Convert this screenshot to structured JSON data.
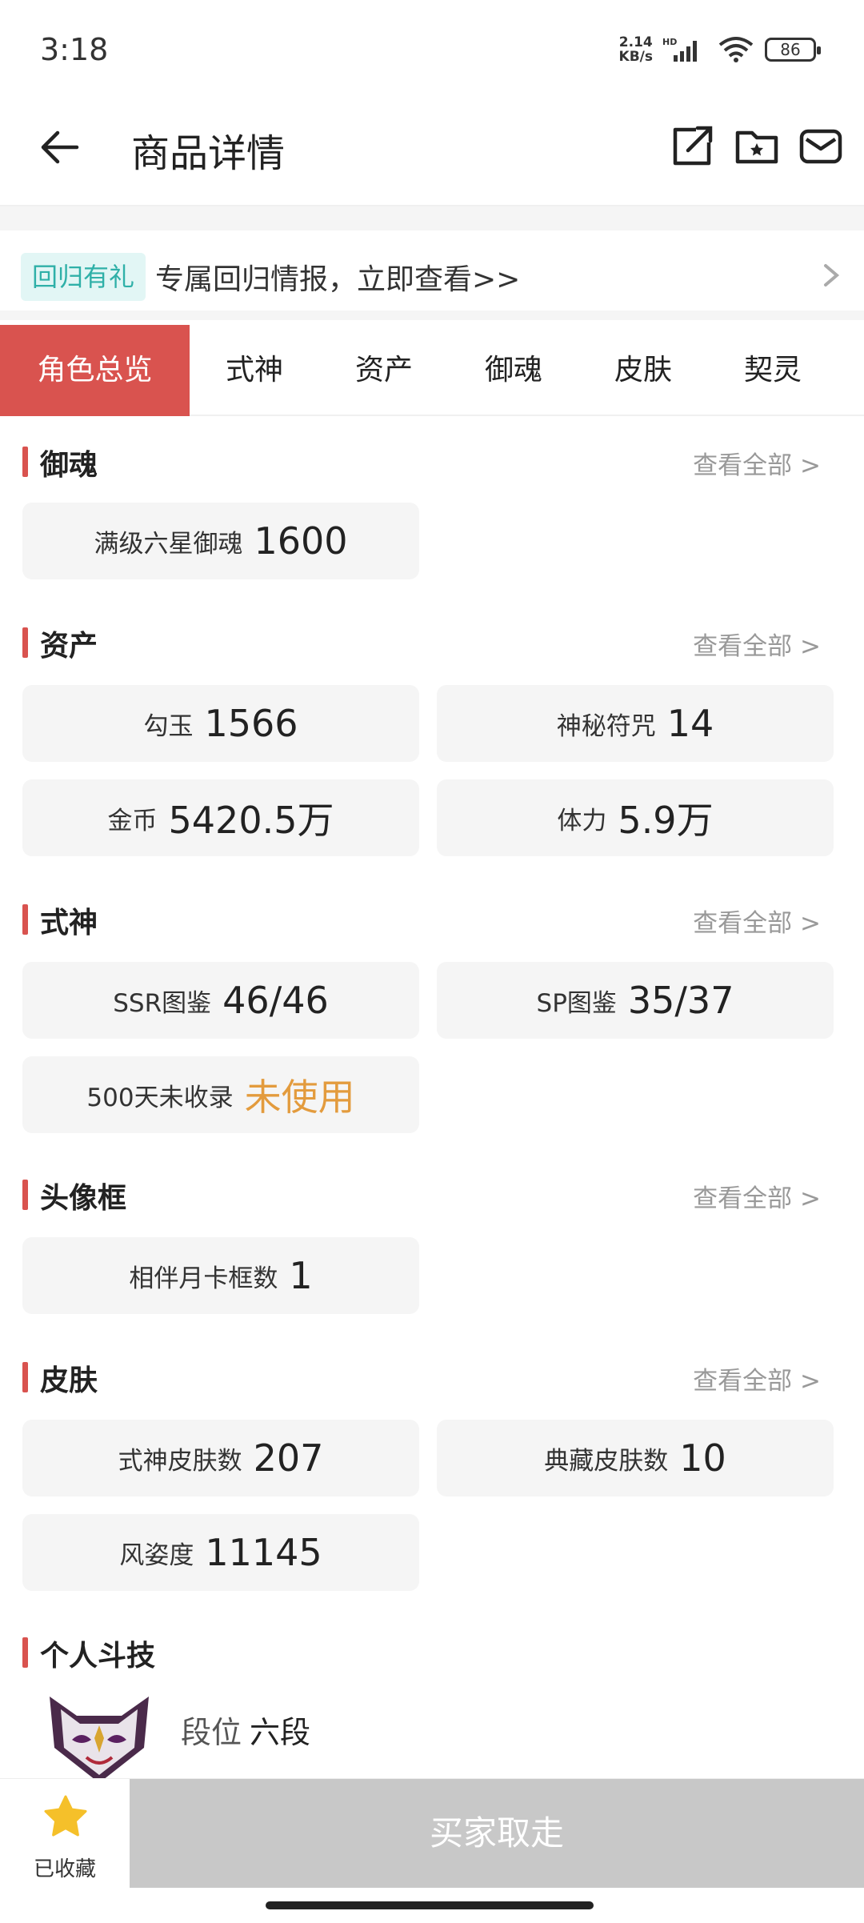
{
  "status": {
    "time": "3:18",
    "net_speed_top": "2.14",
    "net_speed_bottom": "KB/s",
    "signal_label": "HD",
    "battery": "86"
  },
  "header": {
    "title": "商品详情"
  },
  "promo": {
    "badge": "回归有礼",
    "text": "专属回归情报，立即查看>>"
  },
  "tabs": [
    "角色总览",
    "式神",
    "资产",
    "御魂",
    "皮肤",
    "契灵"
  ],
  "view_all_label": "查看全部 >",
  "sections": {
    "yuhun": {
      "title": "御魂",
      "cards": [
        {
          "label": "满级六星御魂",
          "value": "1600"
        }
      ]
    },
    "assets": {
      "title": "资产",
      "cards": [
        {
          "label": "勾玉",
          "value": "1566"
        },
        {
          "label": "神秘符咒",
          "value": "14"
        },
        {
          "label": "金币",
          "value": "5420.5万"
        },
        {
          "label": "体力",
          "value": "5.9万"
        }
      ]
    },
    "shikigami": {
      "title": "式神",
      "cards": [
        {
          "label": "SSR图鉴",
          "value": "46/46"
        },
        {
          "label": "SP图鉴",
          "value": "35/37"
        },
        {
          "label": "500天未收录",
          "value": "未使用"
        }
      ]
    },
    "frames": {
      "title": "头像框",
      "cards": [
        {
          "label": "相伴月卡框数",
          "value": "1"
        }
      ]
    },
    "skins": {
      "title": "皮肤",
      "cards": [
        {
          "label": "式神皮肤数",
          "value": "207"
        },
        {
          "label": "典藏皮肤数",
          "value": "10"
        },
        {
          "label": "风姿度",
          "value": "11145"
        }
      ]
    },
    "pvp": {
      "title": "个人斗技",
      "rank_label": "段位",
      "rank_value": "六段"
    }
  },
  "bottom": {
    "favorite_label": "已收藏",
    "buy_label": "买家取走"
  },
  "colors": {
    "accent": "#d9534f",
    "promo_badge_bg": "#e2f6f5",
    "promo_badge_text": "#2fb0a8",
    "highlight_value": "#e39b3d",
    "disabled_button": "#c8c8c8",
    "favorite_star": "#f5c02a"
  }
}
